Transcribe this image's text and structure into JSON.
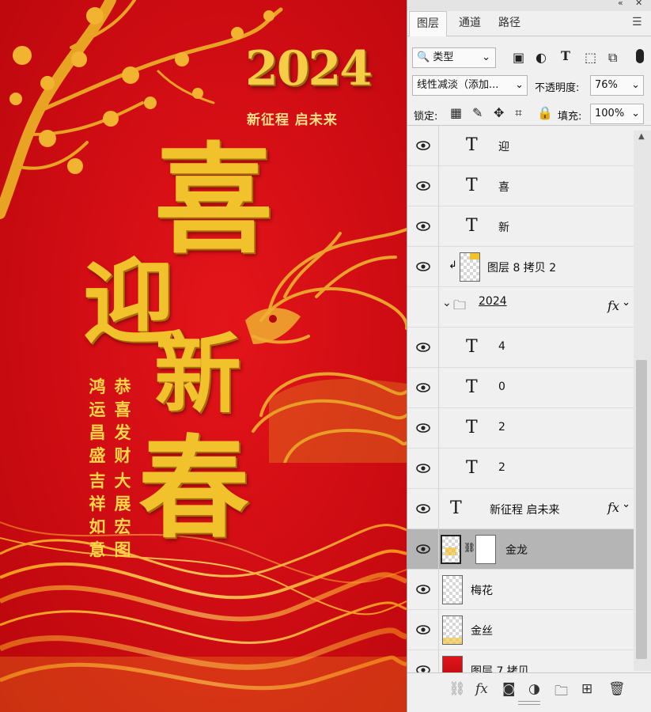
{
  "canvas": {
    "year": "2024",
    "subtitle": "新征程 启未来",
    "big_chars": [
      "喜",
      "迎",
      "新",
      "春"
    ],
    "blessings": [
      {
        "col1": "鸿运昌盛",
        "col2": "恭喜发财"
      },
      {
        "col1": "吉祥如意",
        "col2": "大展宏图"
      }
    ]
  },
  "panel": {
    "tabs": [
      "图层",
      "通道",
      "路径"
    ],
    "filter_label": "类型",
    "blend_mode": "线性减淡（添加...",
    "opacity_label": "不透明度:",
    "opacity_value": "76%",
    "lock_label": "锁定:",
    "fill_label": "填充:",
    "fill_value": "100%",
    "layers": [
      {
        "name": "迎",
        "kind": "text"
      },
      {
        "name": "喜",
        "kind": "text"
      },
      {
        "name": "新",
        "kind": "text"
      },
      {
        "name": "图层 8 拷贝 2",
        "kind": "image"
      },
      {
        "name": "2024",
        "kind": "group"
      },
      {
        "name": "4",
        "kind": "text"
      },
      {
        "name": "0",
        "kind": "text"
      },
      {
        "name": "2",
        "kind": "text"
      },
      {
        "name": "2",
        "kind": "text"
      },
      {
        "name": "新征程  启未来",
        "kind": "text"
      },
      {
        "name": "金龙",
        "kind": "masked"
      },
      {
        "name": "梅花",
        "kind": "image"
      },
      {
        "name": "金丝",
        "kind": "image"
      },
      {
        "name": "图层 7 拷贝",
        "kind": "image"
      }
    ],
    "colors": {
      "poster_red": "#d20d14",
      "gold": "#f2c22c",
      "selected_row": "#b5b5b5"
    }
  }
}
